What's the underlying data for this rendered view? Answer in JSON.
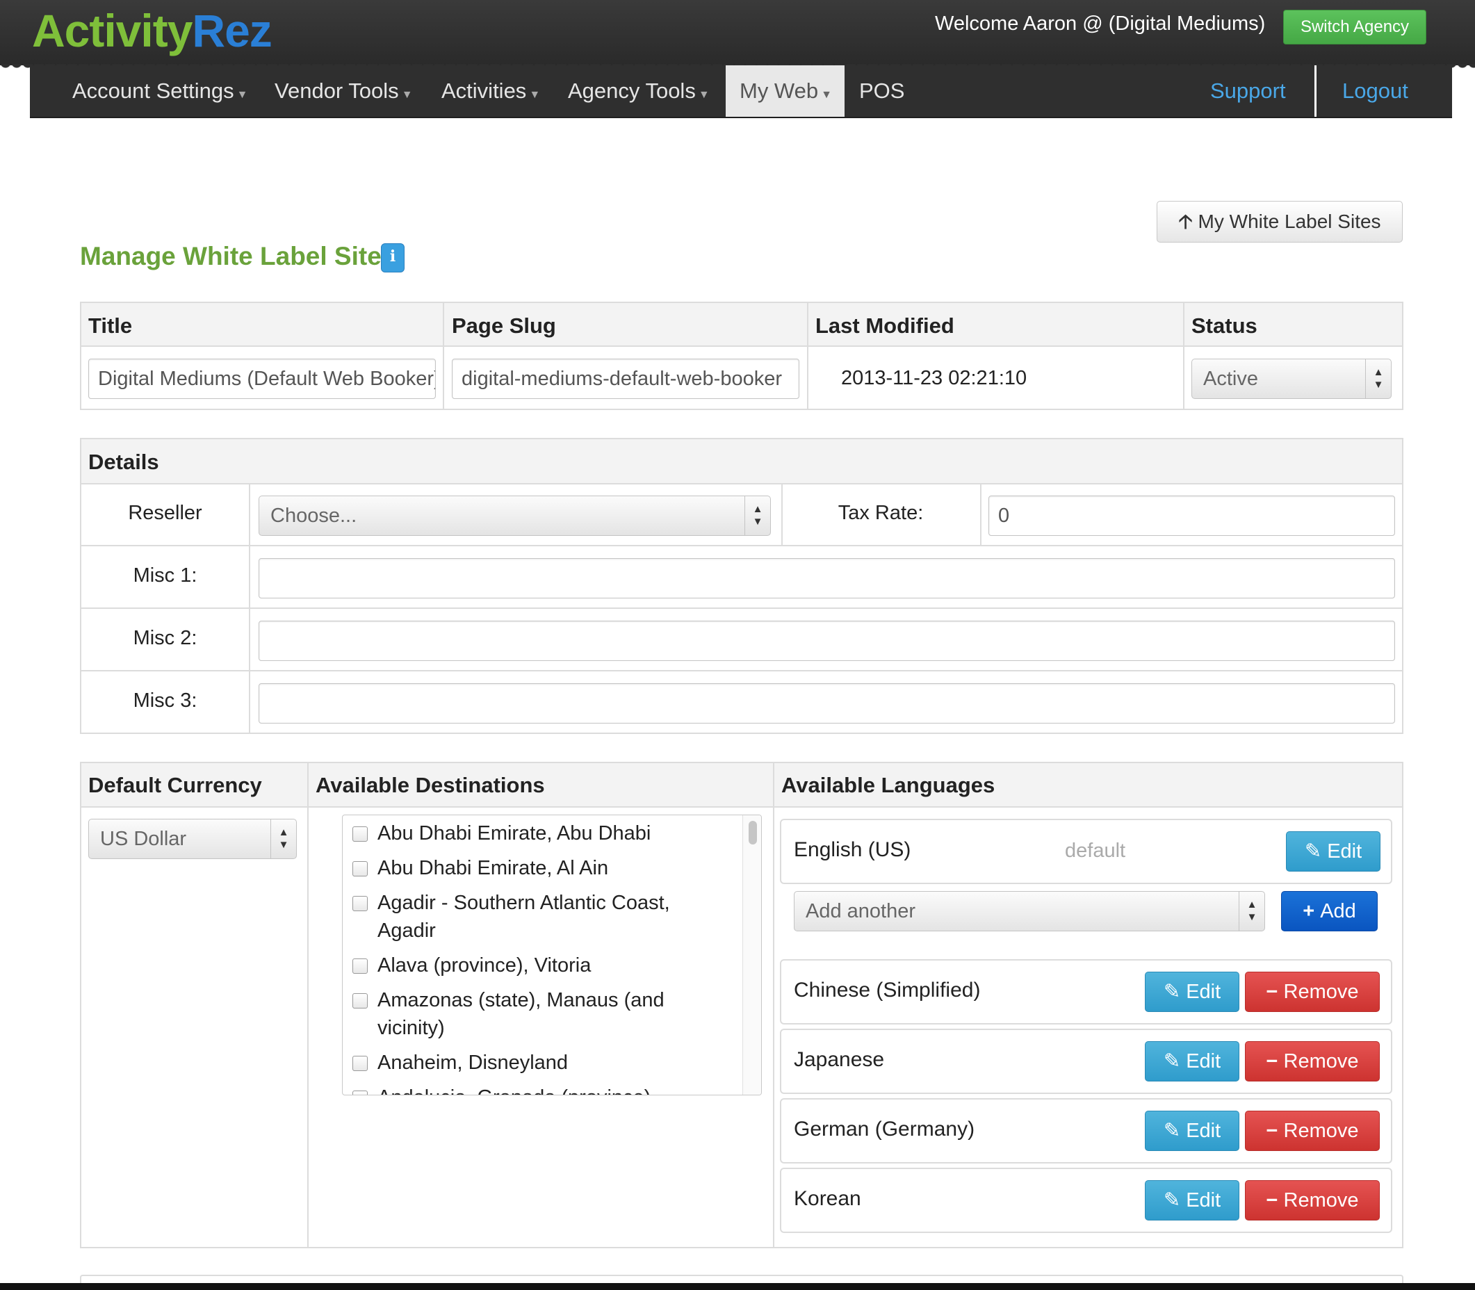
{
  "brand": {
    "logo_part1": "Activity",
    "logo_part2": "Rez"
  },
  "header": {
    "welcome": "Welcome Aaron @ (Digital Mediums)",
    "switch_agency": "Switch Agency"
  },
  "nav": {
    "items": [
      "Account Settings",
      "Vendor Tools",
      "Activities",
      "Agency Tools",
      "My Web",
      "POS"
    ],
    "active": "My Web",
    "support": "Support",
    "logout": "Logout"
  },
  "page": {
    "title": "Manage White Label Site",
    "back_button": "My White Label Sites"
  },
  "site_table": {
    "headers": [
      "Title",
      "Page Slug",
      "Last Modified",
      "Status"
    ],
    "title_value": "Digital Mediums (Default Web Booker)",
    "slug_value": "digital-mediums-default-web-booker",
    "last_modified": "2013-11-23 02:21:10",
    "status_value": "Active"
  },
  "details": {
    "heading": "Details",
    "reseller_label": "Reseller",
    "reseller_value": "Choose...",
    "tax_label": "Tax Rate:",
    "tax_value": "0",
    "misc1_label": "Misc 1:",
    "misc2_label": "Misc 2:",
    "misc3_label": "Misc 3:"
  },
  "options": {
    "currency_heading": "Default Currency",
    "currency_value": "US Dollar",
    "destinations_heading": "Available Destinations",
    "destinations": [
      "Abu Dhabi Emirate, Abu Dhabi",
      "Abu Dhabi Emirate, Al Ain",
      "Agadir - Southern Atlantic Coast, Agadir",
      "Alava (province), Vitoria",
      "Amazonas (state), Manaus (and vicinity)",
      "Anaheim, Disneyland",
      "Andalucia, Granada (province)"
    ],
    "languages_heading": "Available Languages",
    "default_language": "English (US)",
    "default_tag": "default",
    "add_placeholder": "Add another",
    "add_button": "Add",
    "edit_button": "Edit",
    "remove_button": "Remove",
    "languages": [
      "Chinese (Simplified)",
      "Japanese",
      "German (Germany)",
      "Korean"
    ]
  },
  "colors": {
    "brand_green": "#7fbf3a",
    "brand_blue": "#2a7fd6",
    "title_green": "#6aa23b",
    "link_blue": "#4aa8e8"
  }
}
